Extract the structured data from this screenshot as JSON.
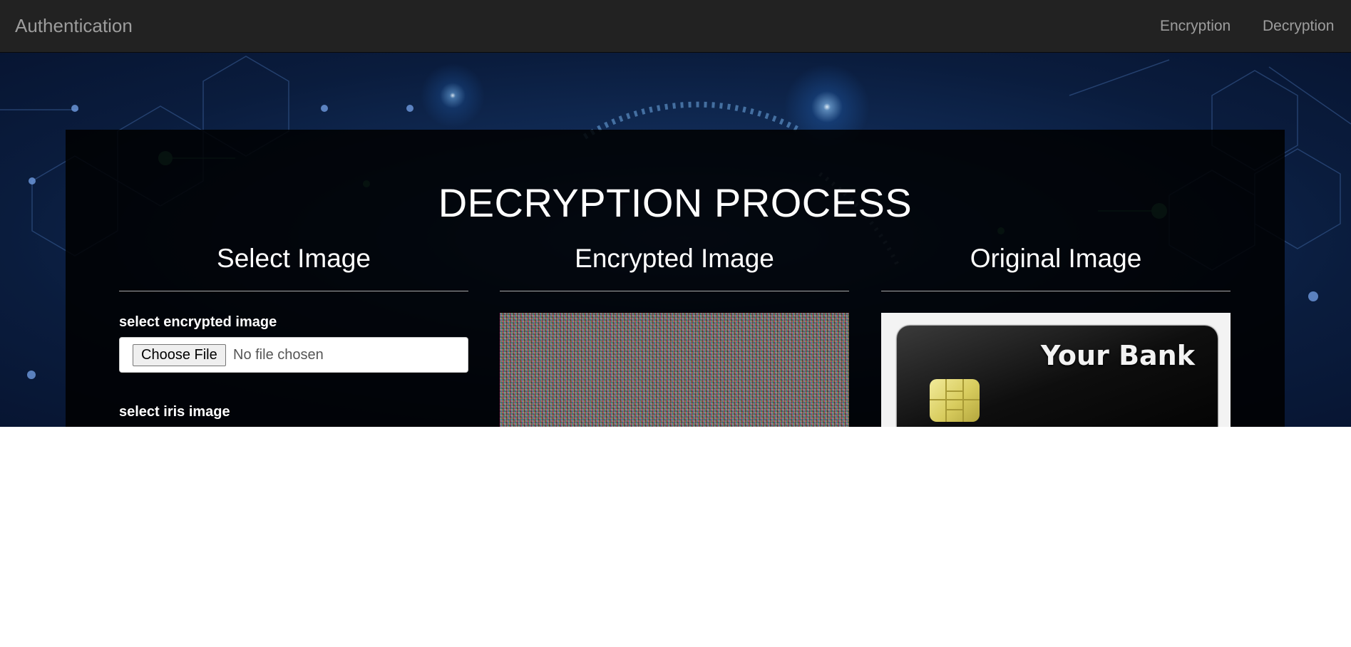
{
  "navbar": {
    "brand": "Authentication",
    "links": [
      "Encryption",
      "Decryption"
    ]
  },
  "main": {
    "title": "DECRYPTION PROCESS",
    "columns": [
      {
        "heading": "Select Image",
        "fields": [
          {
            "label": "select encrypted image",
            "button": "Choose File",
            "status": "No file chosen"
          },
          {
            "label": "select iris image"
          }
        ]
      },
      {
        "heading": "Encrypted Image"
      },
      {
        "heading": "Original Image",
        "card_text": "Your Bank"
      }
    ]
  },
  "colors": {
    "navbar_bg": "#222222",
    "nav_text": "#9d9d9d",
    "panel_bg": "rgba(0,0,0,0.86)",
    "hero_bg": "#0f2a54"
  }
}
